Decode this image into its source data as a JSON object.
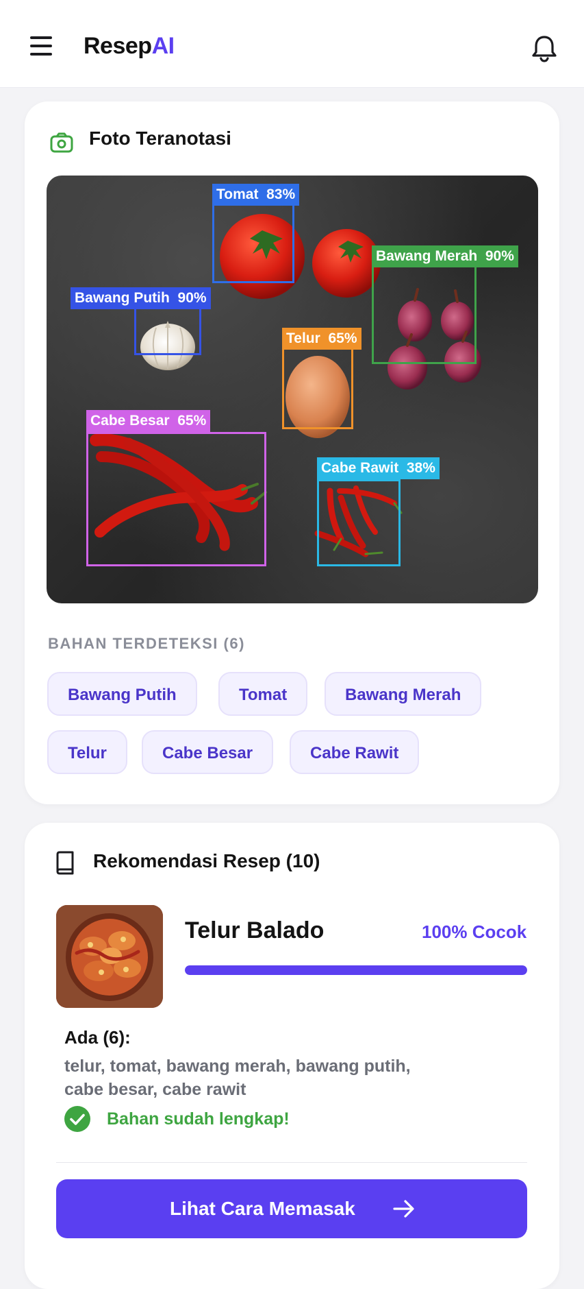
{
  "header": {
    "brand_prefix": "Resep",
    "brand_suffix": "AI",
    "menu_icon": "hamburger-icon",
    "bell_icon": "bell-icon"
  },
  "photo_card": {
    "title": "Foto Teranotasi",
    "icon": "camera-icon",
    "detections": [
      {
        "label": "Tomat",
        "confidence": "83%",
        "color": "#2f6ee8"
      },
      {
        "label": "Bawang Merah",
        "confidence": "90%",
        "color": "#3fa34a"
      },
      {
        "label": "Bawang Putih",
        "confidence": "90%",
        "color": "#3553e6"
      },
      {
        "label": "Telur",
        "confidence": "65%",
        "color": "#f0922a"
      },
      {
        "label": "Cabe Besar",
        "confidence": "65%",
        "color": "#d063e8"
      },
      {
        "label": "Cabe Rawit",
        "confidence": "38%",
        "color": "#2ab9e6"
      }
    ],
    "detected_heading": "BAHAN TERDETEKSI (6)",
    "chips": [
      "Bawang Putih",
      "Tomat",
      "Bawang Merah",
      "Telur",
      "Cabe Besar",
      "Cabe Rawit"
    ]
  },
  "recipe_card": {
    "title": "Rekomendasi Resep (10)",
    "icon": "book-icon",
    "recipe": {
      "name": "Telur Balado",
      "match_label": "100% Cocok",
      "match_fraction": 1.0,
      "have_title": "Ada (6):",
      "have_list": "telur, tomat, bawang merah, bawang putih, cabe besar, cabe rawit",
      "status": "Bahan sudah lengkap!",
      "status_icon": "check-circle-icon"
    },
    "cta_label": "Lihat Cara Memasak",
    "cta_icon": "arrow-right-icon"
  },
  "colors": {
    "accent": "#5b3ff0",
    "success": "#3ea541"
  }
}
